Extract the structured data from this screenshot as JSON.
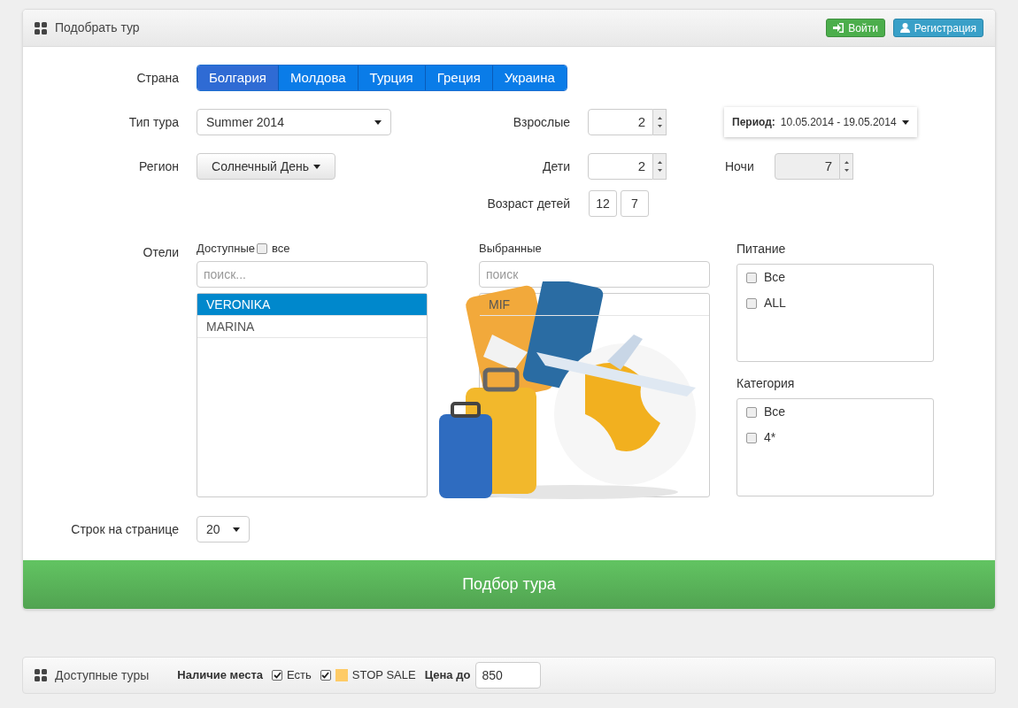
{
  "header": {
    "title": "Подобрать тур",
    "buttons": [
      {
        "label": "Войти",
        "kind": "login"
      },
      {
        "label": "Регистрация",
        "kind": "register"
      }
    ]
  },
  "form": {
    "country": {
      "label": "Страна",
      "tabs": [
        {
          "label": "Болгария",
          "selected": true
        },
        {
          "label": "Молдова",
          "selected": false
        },
        {
          "label": "Турция",
          "selected": false
        },
        {
          "label": "Греция",
          "selected": false
        },
        {
          "label": "Украина",
          "selected": false
        }
      ]
    },
    "tour_type": {
      "label": "Тип тура",
      "value": "Summer 2014"
    },
    "adults": {
      "label": "Взрослые",
      "value": "2"
    },
    "period": {
      "label": "Период:",
      "value": "10.05.2014 - 19.05.2014"
    },
    "region": {
      "label": "Регион",
      "value": "Солнечный День"
    },
    "children": {
      "label": "Дети",
      "value": "2"
    },
    "nights": {
      "label": "Ночи",
      "value": "7",
      "disabled": true
    },
    "children_ages": {
      "label": "Возраст детей",
      "values": [
        "12",
        "7"
      ]
    },
    "hotels": {
      "label": "Отели",
      "available": {
        "label": "Доступные",
        "all_label": "все",
        "all_checked": false,
        "placeholder": "поиск...",
        "items": [
          {
            "name": "VERONIKA",
            "selected": true
          },
          {
            "name": "MARINA",
            "selected": false
          }
        ]
      },
      "chosen": {
        "label": "Выбранные",
        "placeholder": "поиск",
        "items": [
          {
            "name": "MIF",
            "selected": false
          }
        ]
      }
    },
    "meals": {
      "label": "Питание",
      "options": [
        {
          "label": "Все",
          "checked": false
        },
        {
          "label": "ALL",
          "checked": false
        }
      ]
    },
    "category": {
      "label": "Категория",
      "options": [
        {
          "label": "Все",
          "checked": false
        },
        {
          "label": "4*",
          "checked": false
        }
      ]
    },
    "rows_per_page": {
      "label": "Строк на странице",
      "value": "20"
    },
    "submit": "Подбор тура"
  },
  "tours_bar": {
    "title": "Доступные туры",
    "availability_label": "Наличие места",
    "filters": [
      {
        "label": "Есть",
        "checked": true
      },
      {
        "label": "STOP SALE",
        "checked": true,
        "color": "#fecb66"
      }
    ],
    "price_label": "Цена до",
    "price_value": "850"
  }
}
